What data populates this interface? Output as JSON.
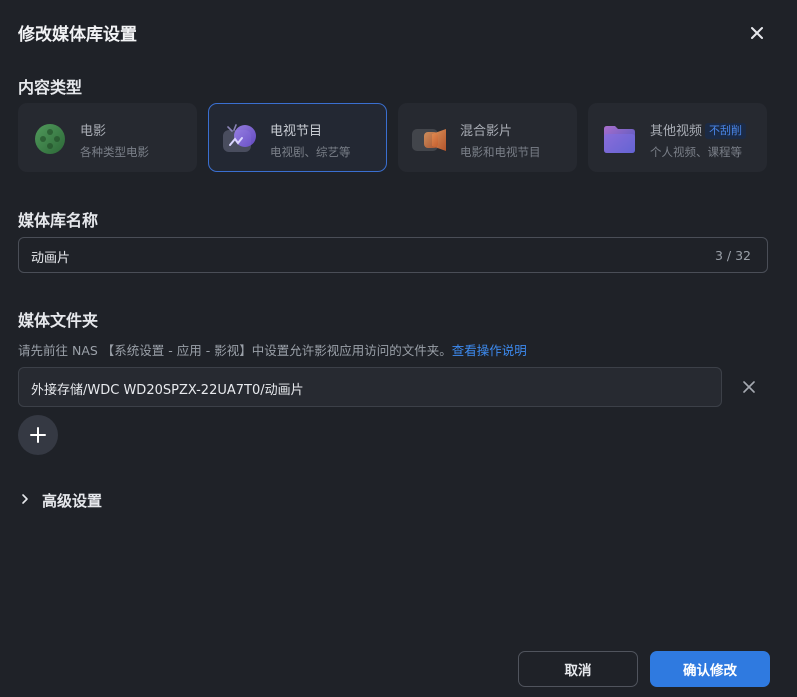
{
  "dialog": {
    "title": "修改媒体库设置"
  },
  "content_type": {
    "label": "内容类型",
    "options": [
      {
        "name": "电影",
        "desc": "各种类型电影",
        "icon": "film-reel-icon",
        "selected": false
      },
      {
        "name": "电视节目",
        "desc": "电视剧、综艺等",
        "icon": "tv-icon",
        "selected": true
      },
      {
        "name": "混合影片",
        "desc": "电影和电视节目",
        "icon": "camera-icon",
        "selected": false
      },
      {
        "name": "其他视频",
        "tag": "不刮削",
        "desc": "个人视频、课程等",
        "icon": "folder-icon",
        "selected": false
      }
    ]
  },
  "library_name": {
    "label": "媒体库名称",
    "value": "动画片",
    "counter": "3 / 32"
  },
  "media_folder": {
    "label": "媒体文件夹",
    "hint": "请先前往 NAS 【系统设置 - 应用 - 影视】中设置允许影视应用访问的文件夹。",
    "hint_link": "查看操作说明",
    "folders": [
      {
        "path": "外接存储/WDC WD20SPZX-22UA7T0/动画片"
      }
    ]
  },
  "advanced": {
    "label": "高级设置"
  },
  "footer": {
    "cancel_label": "取消",
    "confirm_label": "确认修改"
  },
  "colors": {
    "background": "#1f2228",
    "accent": "#2f7ae0",
    "link": "#3d8bf0",
    "selected_border": "#3a6fd0"
  }
}
